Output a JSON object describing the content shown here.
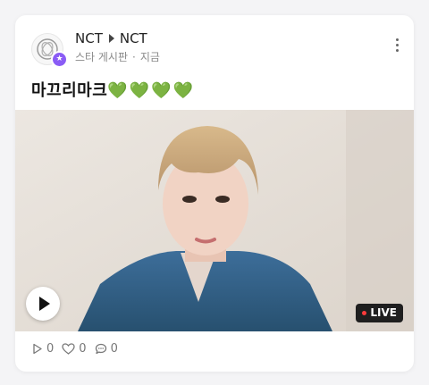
{
  "post": {
    "source_channel": "NCT",
    "target_channel": "NCT",
    "board_name": "스타 게시판",
    "time_ago": "지금",
    "title_text": "마끄리마크",
    "title_emoji": "💚💚💚💚",
    "badge_icon": "star-icon",
    "live_label": "LIVE",
    "accent_color": "#8a5cf5",
    "heart_color": "#3bbf3b"
  },
  "stats": {
    "plays": "0",
    "likes": "0",
    "comments": "0"
  }
}
